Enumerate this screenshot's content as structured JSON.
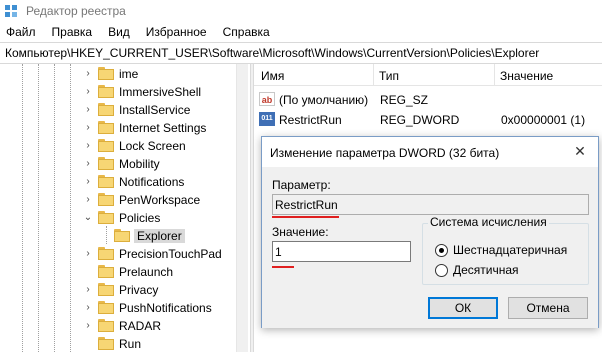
{
  "window": {
    "title": "Редактор реестра",
    "icon": "registry-editor-icon"
  },
  "menu": [
    "Файл",
    "Правка",
    "Вид",
    "Избранное",
    "Справка"
  ],
  "address": "Компьютер\\HKEY_CURRENT_USER\\Software\\Microsoft\\Windows\\CurrentVersion\\Policies\\Explorer",
  "tree": {
    "items": [
      {
        "label": "ime",
        "expander": "›"
      },
      {
        "label": "ImmersiveShell",
        "expander": "›"
      },
      {
        "label": "InstallService",
        "expander": "›"
      },
      {
        "label": "Internet Settings",
        "expander": "›"
      },
      {
        "label": "Lock Screen",
        "expander": "›"
      },
      {
        "label": "Mobility",
        "expander": "›"
      },
      {
        "label": "Notifications",
        "expander": "›"
      },
      {
        "label": "PenWorkspace",
        "expander": "›"
      },
      {
        "label": "Policies",
        "expander": "⌄"
      },
      {
        "label": "Explorer",
        "expander": "",
        "child": true,
        "selected": true
      },
      {
        "label": "PrecisionTouchPad",
        "expander": "›"
      },
      {
        "label": "Prelaunch",
        "expander": ""
      },
      {
        "label": "Privacy",
        "expander": "›"
      },
      {
        "label": "PushNotifications",
        "expander": "›"
      },
      {
        "label": "RADAR",
        "expander": "›"
      },
      {
        "label": "Run",
        "expander": ""
      }
    ]
  },
  "values_list": {
    "columns": [
      "Имя",
      "Тип",
      "Значение"
    ],
    "rows": [
      {
        "icon": "string-value-icon",
        "icon_text": "ab",
        "name": "(По умолчанию)",
        "type": "REG_SZ",
        "data": ""
      },
      {
        "icon": "binary-value-icon",
        "icon_text": "011",
        "name": "RestrictRun",
        "type": "REG_DWORD",
        "data": "0x00000001 (1)"
      }
    ]
  },
  "dialog": {
    "title": "Изменение параметра DWORD (32 бита)",
    "close": "✕",
    "param_label": "Параметр:",
    "param_value": "RestrictRun",
    "value_label": "Значение:",
    "value_value": "1",
    "radix_group": "Система исчисления",
    "radix_options": [
      "Шестнадцатеричная",
      "Десятичная"
    ],
    "radix_selected": "Шестнадцатеричная",
    "ok": "ОК",
    "cancel": "Отмена"
  },
  "colors": {
    "highlight": "#e02020",
    "selection": "#d9d9d9",
    "dialog_border": "#7a9cc6"
  }
}
